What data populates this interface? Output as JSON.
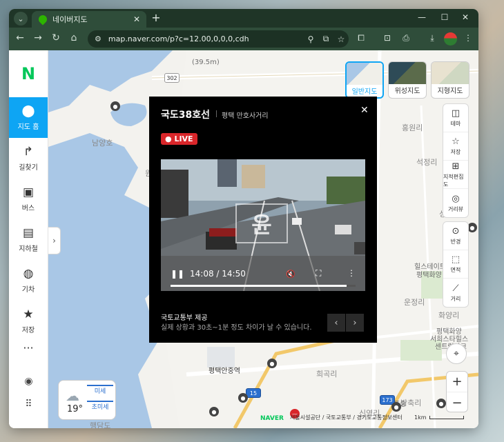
{
  "browser": {
    "tab_title": "네이버지도",
    "url": "map.naver.com/p?c=12.00,0,0,0,cdh"
  },
  "sidebar": {
    "logo": "N",
    "items": [
      {
        "label": "지도 홈",
        "icon": "location-pin-icon"
      },
      {
        "label": "길찾기",
        "icon": "directions-icon"
      },
      {
        "label": "버스",
        "icon": "bus-icon"
      },
      {
        "label": "지하철",
        "icon": "subway-icon"
      },
      {
        "label": "기차",
        "icon": "train-icon"
      },
      {
        "label": "저장",
        "icon": "star-icon"
      }
    ],
    "more": "···"
  },
  "map": {
    "labels": {
      "dist": "(39.5m)",
      "namyangho": "남양호",
      "won": "원",
      "che": "체",
      "hongwonri": "홍원리",
      "seokjeongri": "석정리",
      "seonghwa": "성화",
      "hillstate": "힐스테이트",
      "hillstate2": "평택화양",
      "ungjeongri": "운정리",
      "hwayangri": "화양리",
      "pthy": "평택화양",
      "pthy2": "서희스타힐스",
      "pthy3": "센트럴파크",
      "pt_station": "평택안중역",
      "huigokri": "희곡리",
      "sinyeongri": "신영리",
      "bangchuri": "방축리",
      "poseung": "포승",
      "haengdam": "행담도"
    },
    "routes": [
      "302",
      "15",
      "173"
    ],
    "map_types": [
      {
        "label": "일반지도",
        "active": true
      },
      {
        "label": "위성지도",
        "active": false
      },
      {
        "label": "지형지도",
        "active": false
      }
    ],
    "tools": [
      "테마",
      "저장",
      "지적편집도",
      "거리뷰",
      "반경",
      "면적",
      "거리"
    ],
    "weather": {
      "temp": "19°",
      "fine_dust": "미세",
      "ultra_fine_dust": "초미세"
    },
    "footer": {
      "brand": "NAVER",
      "credits": "서울시설공단 / 국토교통부 / 경기도교통정보센터",
      "scale": "1km"
    }
  },
  "popup": {
    "title": "국도38호선",
    "subtitle": "평택 만호사거리",
    "live": "LIVE",
    "time": "14:08 / 14:50",
    "progress": 0.95,
    "watermark": "윤",
    "provider": "국토교통부 제공",
    "disclaimer": "실제 상황과 30초~1분 정도 차이가 날 수 있습니다."
  }
}
